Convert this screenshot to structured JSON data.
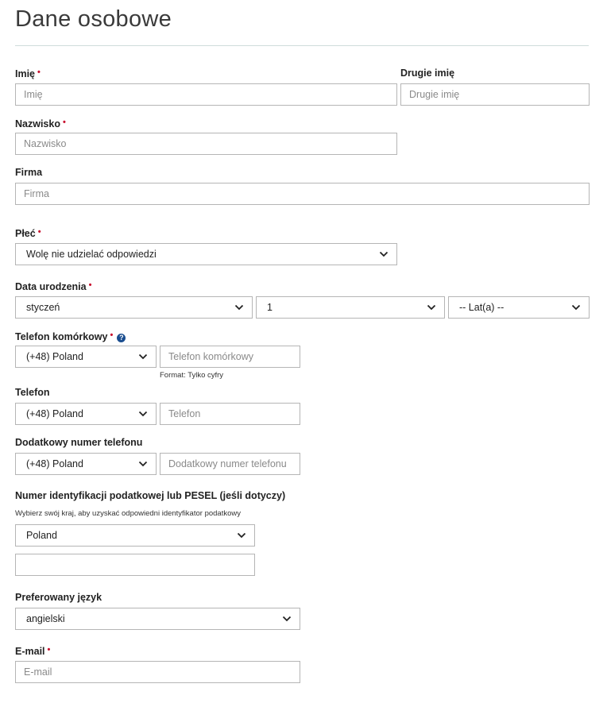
{
  "page": {
    "title": "Dane osobowe"
  },
  "first_name": {
    "label": "Imię",
    "placeholder": "Imię",
    "required": "•"
  },
  "middle_name": {
    "label": "Drugie imię",
    "placeholder": "Drugie imię"
  },
  "last_name": {
    "label": "Nazwisko",
    "placeholder": "Nazwisko",
    "required": "•"
  },
  "company": {
    "label": "Firma",
    "placeholder": "Firma"
  },
  "gender": {
    "label": "Płeć",
    "required": "•",
    "value": "Wolę nie udzielać odpowiedzi"
  },
  "birth_date": {
    "label": "Data urodzenia",
    "required": "•",
    "month": "styczeń",
    "day": "1",
    "year": "-- Lat(a) --"
  },
  "mobile_phone": {
    "label": "Telefon komórkowy",
    "required": "•",
    "help_icon": "?",
    "country": "(+48) Poland",
    "placeholder": "Telefon komórkowy",
    "hint": "Format: Tylko cyfry"
  },
  "phone": {
    "label": "Telefon",
    "country": "(+48) Poland",
    "placeholder": "Telefon"
  },
  "additional_phone": {
    "label": "Dodatkowy numer telefonu",
    "country": "(+48) Poland",
    "placeholder": "Dodatkowy numer telefonu"
  },
  "tax_id": {
    "label": "Numer identyfikacji podatkowej lub PESEL (jeśli dotyczy)",
    "hint": "Wybierz swój kraj, aby uzyskać odpowiedni identyfikator podatkowy",
    "country": "Poland",
    "value": ""
  },
  "language": {
    "label": "Preferowany język",
    "value": "angielski"
  },
  "email": {
    "label": "E-mail",
    "required": "•",
    "placeholder": "E-mail"
  },
  "icons": {
    "select_arrow": "chevron-down-icon",
    "help": "question-circle-icon"
  },
  "colors": {
    "required": "#c8102e",
    "help_icon": "#1a4d8f",
    "border": "#b5b5b5",
    "divider": "#cfdcda"
  }
}
